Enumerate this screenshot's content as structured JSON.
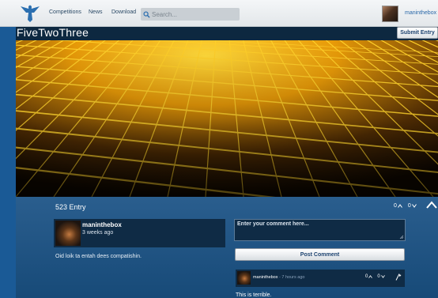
{
  "nav": {
    "logo_icon": "bird-wings-logo-icon",
    "links": [
      "Competitions",
      "News",
      "Download"
    ],
    "search_placeholder": "Search...",
    "user": "maninthebox"
  },
  "title_bar": {
    "title": "FiveTwoThree",
    "submit_label": "Submit Entry"
  },
  "hero": {
    "description_icon": "golden-cubes-image"
  },
  "entry": {
    "count_label": "523 Entry",
    "upvotes": "0",
    "downvotes": "0",
    "author": "maninthebox",
    "time": "3 weeks ago",
    "description": "Oid loik ta entah dees compatishin."
  },
  "comment_form": {
    "placeholder": "Enter your comment here...",
    "post_label": "Post Comment"
  },
  "comments": [
    {
      "author": "maninthebox",
      "separator": "-",
      "time": "7 hours ago",
      "upvotes": "0",
      "downvotes": "0",
      "text": "This is terrible."
    }
  ],
  "colors": {
    "page_bg": "#1a5a96",
    "title_bar": "#0d2840",
    "card_bg": "#0f2b45",
    "link": "#2a68a8",
    "hero_glow": "#ffc400"
  }
}
